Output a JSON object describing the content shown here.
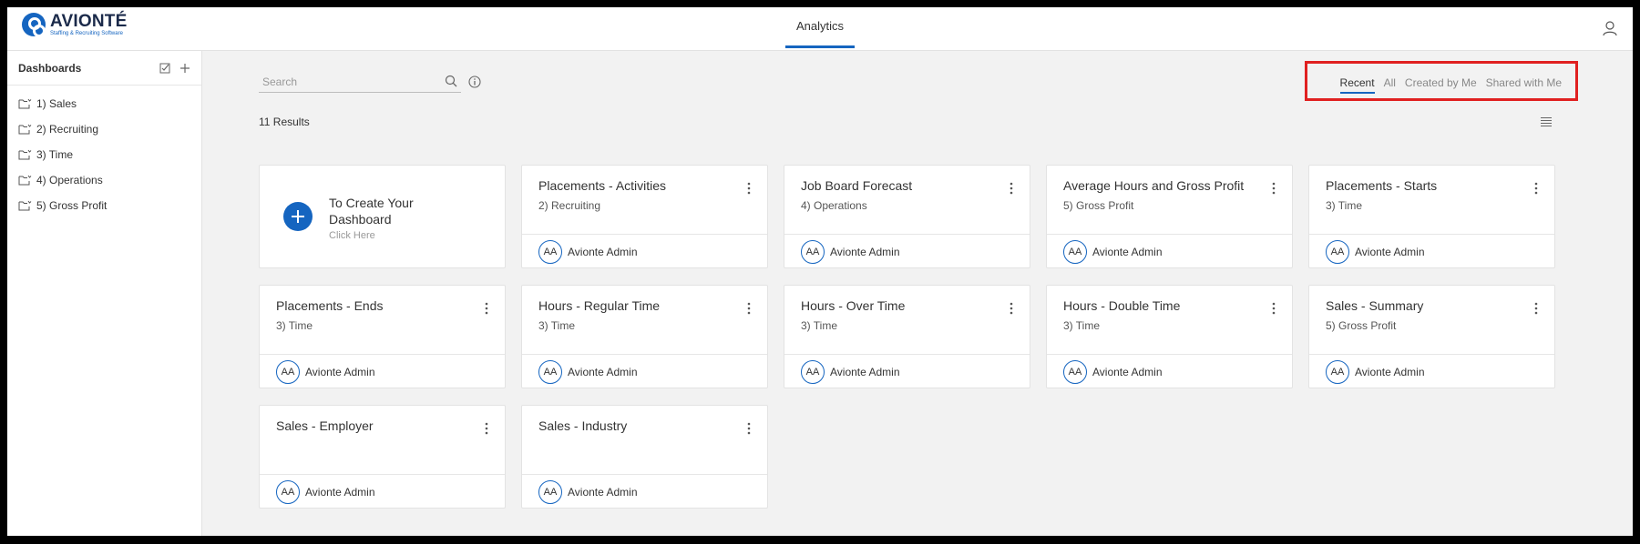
{
  "app": {
    "logo_name": "AVIONTÉ",
    "logo_tagline": "Staffing & Recruiting Software",
    "nav_tab": "Analytics"
  },
  "sidebar": {
    "title": "Dashboards",
    "items": [
      {
        "label": "1) Sales"
      },
      {
        "label": "2) Recruiting"
      },
      {
        "label": "3) Time"
      },
      {
        "label": "4) Operations"
      },
      {
        "label": "5) Gross Profit"
      }
    ]
  },
  "search": {
    "placeholder": "Search"
  },
  "filters": {
    "items": [
      {
        "label": "Recent",
        "active": true
      },
      {
        "label": "All",
        "active": false
      },
      {
        "label": "Created by Me",
        "active": false
      },
      {
        "label": "Shared with Me",
        "active": false
      }
    ]
  },
  "results_label": "11 Results",
  "create_card": {
    "title": "To Create Your Dashboard",
    "subtitle": "Click Here"
  },
  "cards": [
    {
      "title": "Placements - Activities",
      "folder": "2) Recruiting",
      "owner_initials": "AA",
      "owner": "Avionte Admin"
    },
    {
      "title": "Job Board Forecast",
      "folder": "4) Operations",
      "owner_initials": "AA",
      "owner": "Avionte Admin"
    },
    {
      "title": "Average Hours and Gross Profit",
      "folder": "5) Gross Profit",
      "owner_initials": "AA",
      "owner": "Avionte Admin"
    },
    {
      "title": "Placements - Starts",
      "folder": "3) Time",
      "owner_initials": "AA",
      "owner": "Avionte Admin"
    },
    {
      "title": "Placements - Ends",
      "folder": "3) Time",
      "owner_initials": "AA",
      "owner": "Avionte Admin"
    },
    {
      "title": "Hours - Regular Time",
      "folder": "3) Time",
      "owner_initials": "AA",
      "owner": "Avionte Admin"
    },
    {
      "title": "Hours - Over Time",
      "folder": "3) Time",
      "owner_initials": "AA",
      "owner": "Avionte Admin"
    },
    {
      "title": "Hours - Double Time",
      "folder": "3) Time",
      "owner_initials": "AA",
      "owner": "Avionte Admin"
    },
    {
      "title": "Sales - Summary",
      "folder": "5) Gross Profit",
      "owner_initials": "AA",
      "owner": "Avionte Admin"
    },
    {
      "title": "Sales - Employer",
      "folder": "",
      "owner_initials": "AA",
      "owner": "Avionte Admin"
    },
    {
      "title": "Sales - Industry",
      "folder": "",
      "owner_initials": "AA",
      "owner": "Avionte Admin"
    }
  ],
  "colors": {
    "accent": "#1565c0",
    "highlight": "#e02020",
    "background": "#f2f2f2"
  }
}
